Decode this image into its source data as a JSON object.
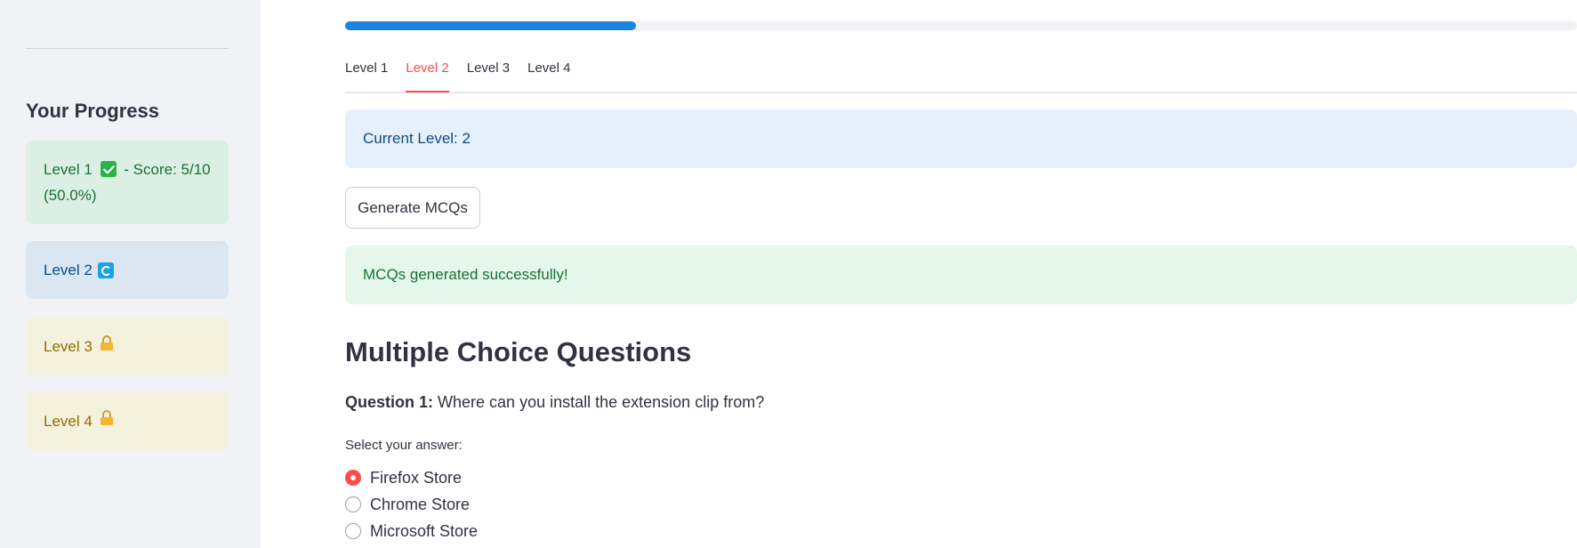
{
  "sidebar": {
    "title": "Your Progress",
    "levels": [
      {
        "label": "Level 1",
        "status": "completed",
        "icon": "check-icon",
        "score_text": "- Score: 5/10 (50.0%)"
      },
      {
        "label": "Level 2",
        "status": "in-progress",
        "icon": "refresh-icon"
      },
      {
        "label": "Level 3",
        "status": "locked",
        "icon": "lock-icon"
      },
      {
        "label": "Level 4",
        "status": "locked",
        "icon": "lock-icon"
      }
    ]
  },
  "main": {
    "progress_fraction": 0.236,
    "tabs": [
      {
        "label": "Level 1",
        "active": false
      },
      {
        "label": "Level 2",
        "active": true
      },
      {
        "label": "Level 3",
        "active": false
      },
      {
        "label": "Level 4",
        "active": false
      }
    ],
    "info_alert": "Current Level: 2",
    "generate_button": "Generate MCQs",
    "success_alert": "MCQs generated successfully!",
    "section_heading": "Multiple Choice Questions",
    "question": {
      "prefix": "Question 1:",
      "text": "Where can you install the extension clip from?"
    },
    "select_label": "Select your answer:",
    "options": [
      {
        "label": "Firefox Store",
        "selected": true
      },
      {
        "label": "Chrome Store",
        "selected": false
      },
      {
        "label": "Microsoft Store",
        "selected": false
      }
    ]
  },
  "colors": {
    "accent": "#ff4b4b",
    "progress": "#1c83e1",
    "success": "#177233",
    "info": "#0f4c81",
    "warning": "#926c05"
  }
}
